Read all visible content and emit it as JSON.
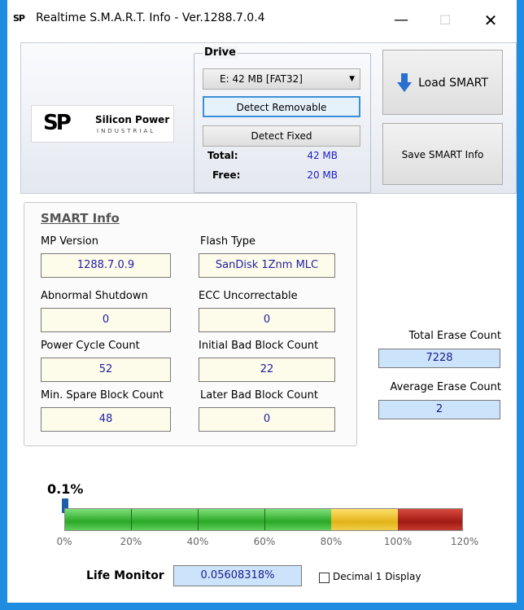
{
  "window": {
    "icon_text": "SP",
    "title": "Realtime S.M.A.R.T. Info - Ver.1288.7.0.4",
    "min_glyph": "—",
    "max_glyph": "☐",
    "close_glyph": "✕"
  },
  "logo": {
    "mark": "SP",
    "name": "Silicon Power",
    "sub": "INDUSTRIAL"
  },
  "drive": {
    "group_label": "Drive",
    "selected": "E:  42 MB [FAT32]",
    "detect_removable": "Detect Removable",
    "detect_fixed": "Detect Fixed",
    "total_label": "Total:",
    "total_value": "42 MB",
    "free_label": "Free:",
    "free_value": "20 MB"
  },
  "actions": {
    "load_smart": "Load SMART",
    "save_smart": "Save SMART Info"
  },
  "smart": {
    "title": "SMART Info",
    "mp_version_label": "MP Version",
    "mp_version": "1288.7.0.9",
    "flash_type_label": "Flash Type",
    "flash_type": "SanDisk 1Znm MLC",
    "abnormal_shutdown_label": "Abnormal Shutdown",
    "abnormal_shutdown": "0",
    "ecc_label": "ECC Uncorrectable",
    "ecc": "0",
    "power_cycle_label": "Power Cycle Count",
    "power_cycle": "52",
    "initial_bad_label": "Initial Bad Block Count",
    "initial_bad": "22",
    "min_spare_label": "Min. Spare Block Count",
    "min_spare": "48",
    "later_bad_label": "Later Bad Block Count",
    "later_bad": "0",
    "total_erase_label": "Total Erase Count",
    "total_erase": "7228",
    "avg_erase_label": "Average Erase Count",
    "avg_erase": "2"
  },
  "life": {
    "percent_text": "0.1%",
    "fraction_used": 0.001,
    "scale": [
      "0%",
      "20%",
      "40%",
      "60%",
      "80%",
      "100%",
      "120%"
    ],
    "label": "Life Monitor",
    "value": "0.05608318%",
    "decimal_label": "Decimal 1 Display",
    "decimal_checked": false
  },
  "colors": {
    "frame": "#1e8ce0",
    "good": "#2aa826",
    "warn": "#e2b31a",
    "bad": "#a11b14"
  }
}
